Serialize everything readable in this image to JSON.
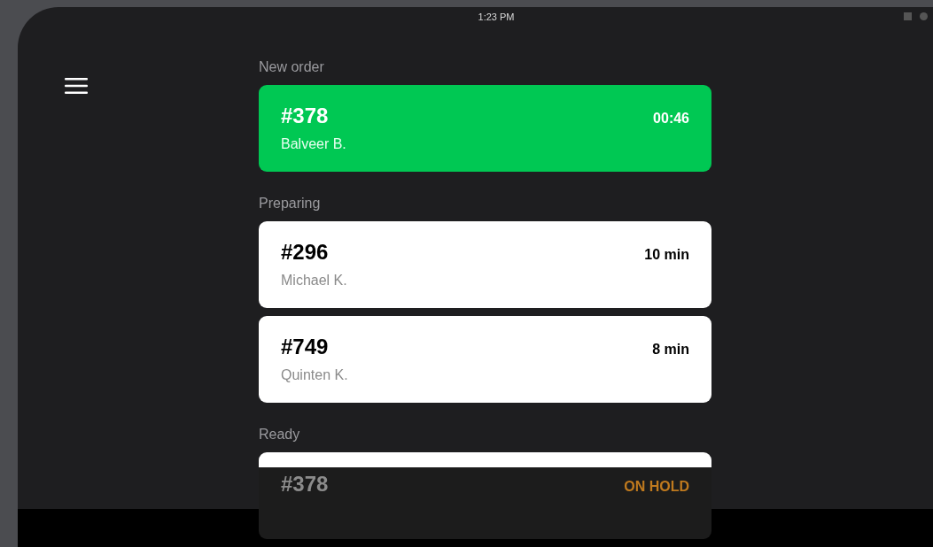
{
  "status_bar": {
    "time": "1:23 PM"
  },
  "sections": [
    {
      "title": "New order",
      "kind": "new",
      "orders": [
        {
          "number": "#378",
          "customer": "Balveer B.",
          "status": "00:46"
        }
      ]
    },
    {
      "title": "Preparing",
      "kind": "preparing",
      "orders": [
        {
          "number": "#296",
          "customer": "Michael K.",
          "status": "10 min"
        },
        {
          "number": "#749",
          "customer": "Quinten K.",
          "status": "8 min"
        }
      ]
    },
    {
      "title": "Ready",
      "kind": "ready",
      "orders": [
        {
          "number": "#378",
          "status": "ON HOLD"
        }
      ]
    }
  ]
}
